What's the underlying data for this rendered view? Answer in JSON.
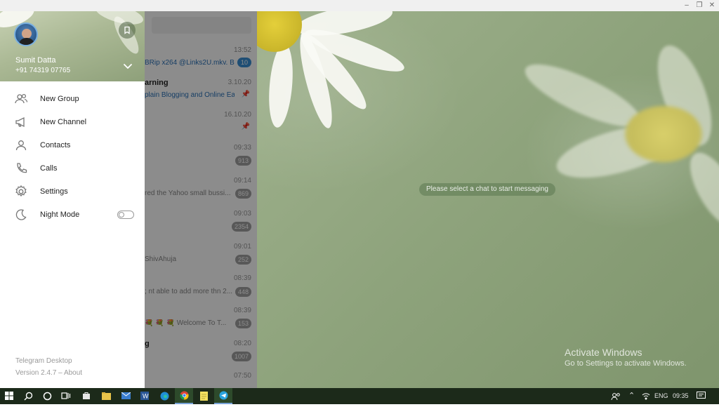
{
  "profile": {
    "name": "Sumit Datta",
    "phone": "+91 74319 07765"
  },
  "menu": {
    "items": [
      {
        "label": "New Group",
        "icon": "new-group-icon"
      },
      {
        "label": "New Channel",
        "icon": "megaphone-icon"
      },
      {
        "label": "Contacts",
        "icon": "contacts-icon"
      },
      {
        "label": "Calls",
        "icon": "phone-icon"
      },
      {
        "label": "Settings",
        "icon": "gear-icon"
      },
      {
        "label": "Night Mode",
        "icon": "moon-icon",
        "toggle": false
      }
    ],
    "footer_app": "Telegram Desktop",
    "footer_version": "Version 2.4.7 – About"
  },
  "chats": [
    {
      "title": "",
      "time": "13:52",
      "preview": "BRip x264 @Links2U.mkv. B...",
      "badge": "10",
      "badge_style": "blue"
    },
    {
      "title": "arning",
      "time": "3.10.20",
      "preview": "plain Blogging and Online Ea...",
      "pinned": true
    },
    {
      "title": "",
      "time": "16.10.20",
      "preview": "",
      "pinned": true
    },
    {
      "title": "",
      "time": "09:33",
      "preview": "",
      "badge": "913"
    },
    {
      "title": "",
      "time": "09:14",
      "preview": "red the Yahoo small bussi...",
      "badge": "869"
    },
    {
      "title": "",
      "time": "09:03",
      "preview": "",
      "badge": "2354"
    },
    {
      "title": "",
      "time": "09:01",
      "preview": "ShivAhuja",
      "badge": "252"
    },
    {
      "title": "",
      "time": "08:39",
      "preview": "; nt able to add more thn 2...",
      "badge": "448"
    },
    {
      "title": "",
      "time": "08:39",
      "preview": "💐 💐 💐 Welcome To T...",
      "badge": "153"
    },
    {
      "title": "g",
      "time": "08:20",
      "preview": "",
      "badge": "1007"
    },
    {
      "title": "",
      "time": "07:50",
      "preview": ""
    }
  ],
  "main": {
    "empty_message": "Please select a chat to start messaging"
  },
  "watermark": {
    "title": "Activate Windows",
    "subtitle": "Go to Settings to activate Windows."
  },
  "taskbar": {
    "language": "ENG",
    "time": "09:35"
  },
  "colors": {
    "accent": "#3a8fd4",
    "taskbar": "#1c2a1a"
  }
}
